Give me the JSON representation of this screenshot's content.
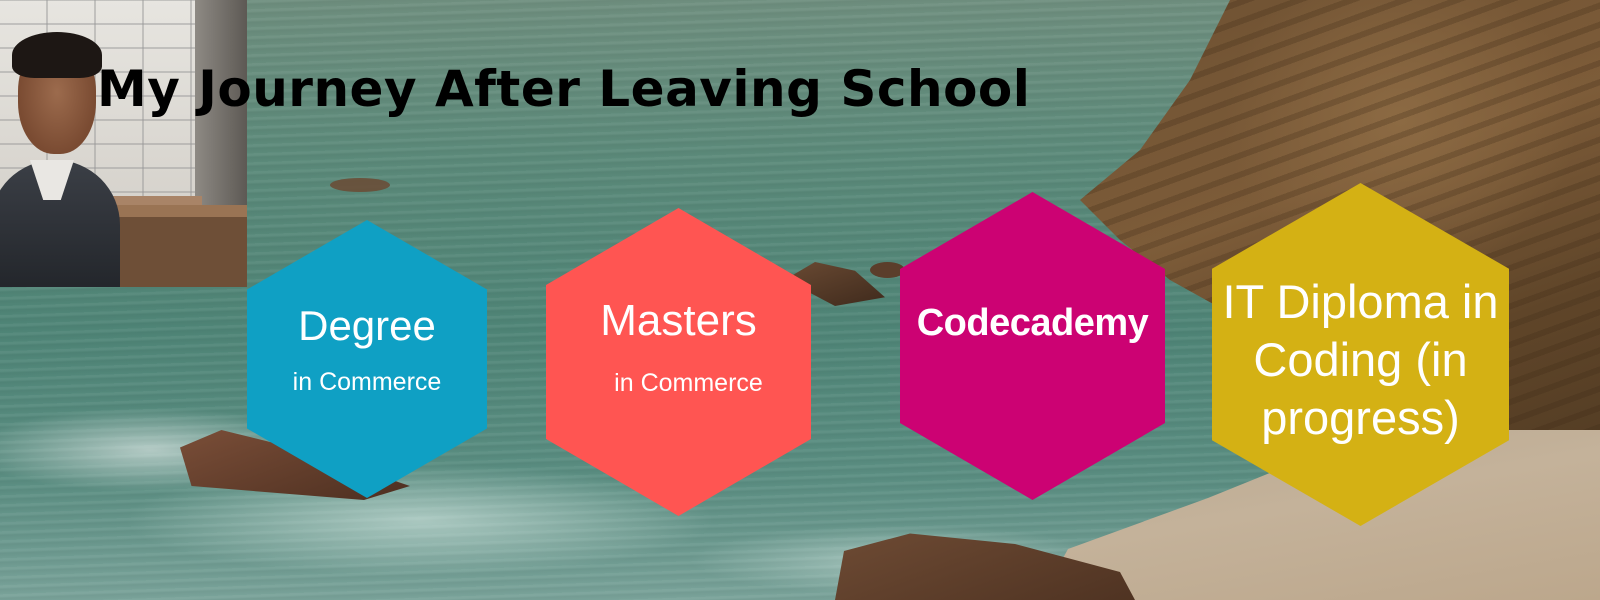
{
  "title": "My Journey After Leaving School",
  "hexagons": [
    {
      "main": "Degree",
      "sub": "in Commerce",
      "color": "#0fa0c4"
    },
    {
      "main": "Masters",
      "sub": "in Commerce",
      "color": "#ff5552"
    },
    {
      "main": "Codecademy",
      "color": "#cc0273"
    },
    {
      "main": "IT Diploma in Coding (in progress)",
      "color": "#d4b114"
    }
  ]
}
